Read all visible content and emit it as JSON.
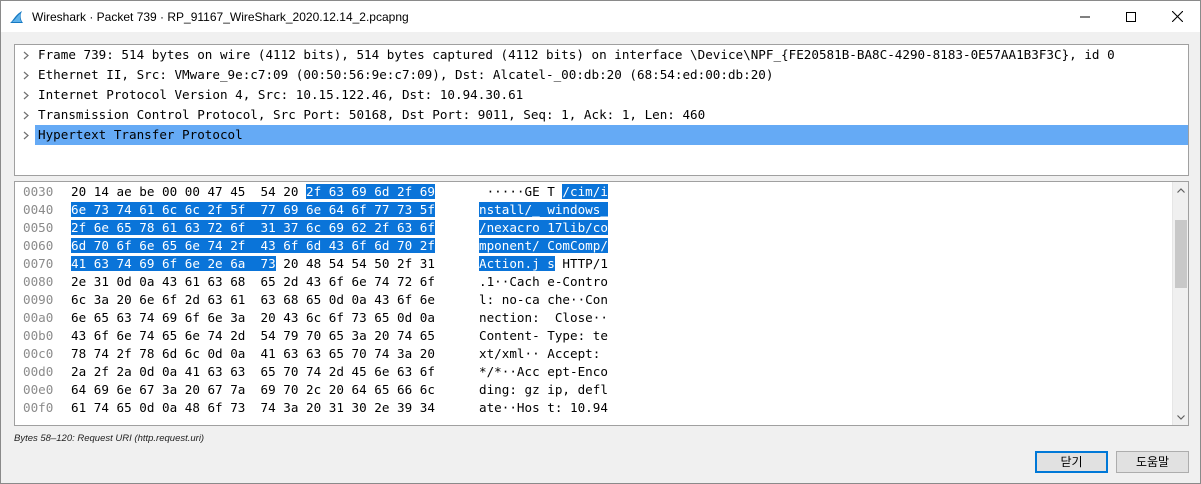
{
  "window": {
    "title": "Wireshark · Packet 739 · RP_91167_WireShark_2020.12.14_2.pcapng",
    "icon": "wireshark-fin-icon"
  },
  "tree": [
    {
      "label": "Frame 739: 514 bytes on wire (4112 bits), 514 bytes captured (4112 bits) on interface \\Device\\NPF_{FE20581B-BA8C-4290-8183-0E57AA1B3F3C}, id 0",
      "selected": false
    },
    {
      "label": "Ethernet II, Src: VMware_9e:c7:09 (00:50:56:9e:c7:09), Dst: Alcatel-_00:db:20 (68:54:ed:00:db:20)",
      "selected": false
    },
    {
      "label": "Internet Protocol Version 4, Src: 10.15.122.46, Dst: 10.94.30.61",
      "selected": false
    },
    {
      "label": "Transmission Control Protocol, Src Port: 50168, Dst Port: 9011, Seq: 1, Ack: 1, Len: 460",
      "selected": false
    },
    {
      "label": "Hypertext Transfer Protocol",
      "selected": true
    }
  ],
  "hex_rows": [
    {
      "offset": "0030",
      "hex_a": "20 14 ae be 00 00 47 45  54 20 ",
      "hex_hl": "2f 63 69 6d 2f 69",
      "hex_b": "",
      "asc_a": " ·····GE T ",
      "asc_hl": "/cim/i",
      "asc_b": ""
    },
    {
      "offset": "0040",
      "hex_a": "",
      "hex_hl": "6e 73 74 61 6c 6c 2f 5f  77 69 6e 64 6f 77 73 5f",
      "hex_b": "",
      "asc_a": "",
      "asc_hl": "nstall/_ windows_",
      "asc_b": ""
    },
    {
      "offset": "0050",
      "hex_a": "",
      "hex_hl": "2f 6e 65 78 61 63 72 6f  31 37 6c 69 62 2f 63 6f",
      "hex_b": "",
      "asc_a": "",
      "asc_hl": "/nexacro 17lib/co",
      "asc_b": ""
    },
    {
      "offset": "0060",
      "hex_a": "",
      "hex_hl": "6d 70 6f 6e 65 6e 74 2f  43 6f 6d 43 6f 6d 70 2f",
      "hex_b": "",
      "asc_a": "",
      "asc_hl": "mponent/ ComComp/",
      "asc_b": ""
    },
    {
      "offset": "0070",
      "hex_a": "",
      "hex_hl": "41 63 74 69 6f 6e 2e 6a  73",
      "hex_b": " 20 48 54 54 50 2f 31",
      "asc_a": "",
      "asc_hl": "Action.j s",
      "asc_b": " HTTP/1"
    },
    {
      "offset": "0080",
      "hex_a": "2e 31 0d 0a 43 61 63 68  65 2d 43 6f 6e 74 72 6f",
      "hex_hl": "",
      "hex_b": "",
      "asc_a": ".1··Cach e-Contro",
      "asc_hl": "",
      "asc_b": ""
    },
    {
      "offset": "0090",
      "hex_a": "6c 3a 20 6e 6f 2d 63 61  63 68 65 0d 0a 43 6f 6e",
      "hex_hl": "",
      "hex_b": "",
      "asc_a": "l: no-ca che··Con",
      "asc_hl": "",
      "asc_b": ""
    },
    {
      "offset": "00a0",
      "hex_a": "6e 65 63 74 69 6f 6e 3a  20 43 6c 6f 73 65 0d 0a",
      "hex_hl": "",
      "hex_b": "",
      "asc_a": "nection:  Close··",
      "asc_hl": "",
      "asc_b": ""
    },
    {
      "offset": "00b0",
      "hex_a": "43 6f 6e 74 65 6e 74 2d  54 79 70 65 3a 20 74 65",
      "hex_hl": "",
      "hex_b": "",
      "asc_a": "Content- Type: te",
      "asc_hl": "",
      "asc_b": ""
    },
    {
      "offset": "00c0",
      "hex_a": "78 74 2f 78 6d 6c 0d 0a  41 63 63 65 70 74 3a 20",
      "hex_hl": "",
      "hex_b": "",
      "asc_a": "xt/xml·· Accept: ",
      "asc_hl": "",
      "asc_b": ""
    },
    {
      "offset": "00d0",
      "hex_a": "2a 2f 2a 0d 0a 41 63 63  65 70 74 2d 45 6e 63 6f",
      "hex_hl": "",
      "hex_b": "",
      "asc_a": "*/*··Acc ept-Enco",
      "asc_hl": "",
      "asc_b": ""
    },
    {
      "offset": "00e0",
      "hex_a": "64 69 6e 67 3a 20 67 7a  69 70 2c 20 64 65 66 6c",
      "hex_hl": "",
      "hex_b": "",
      "asc_a": "ding: gz ip, defl",
      "asc_hl": "",
      "asc_b": ""
    },
    {
      "offset": "00f0",
      "hex_a": "61 74 65 0d 0a 48 6f 73  74 3a 20 31 30 2e 39 34",
      "hex_hl": "",
      "hex_b": "",
      "asc_a": "ate··Hos t: 10.94",
      "asc_hl": "",
      "asc_b": ""
    }
  ],
  "status": "Bytes 58–120: Request URI (http.request.uri)",
  "buttons": {
    "close_label": "닫기",
    "help_label": "도움말"
  },
  "colors": {
    "selection": "#65aaf5",
    "byte_highlight": "#0a74d9",
    "default_button_border": "#0078d7"
  }
}
